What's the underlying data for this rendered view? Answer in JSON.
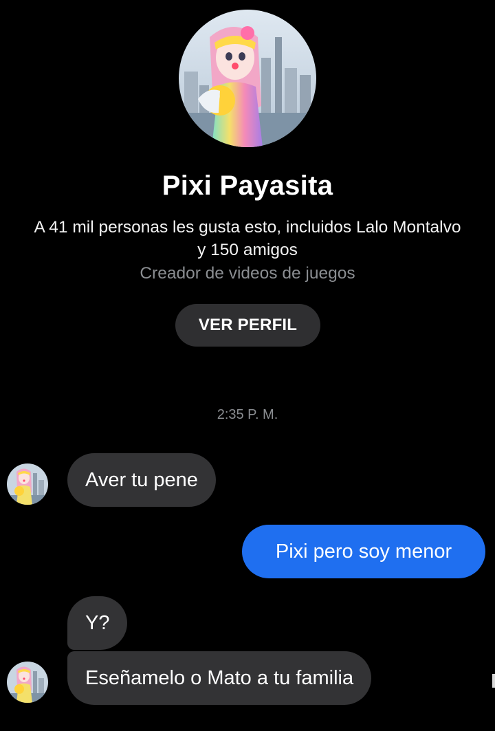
{
  "profile": {
    "name": "Pixi Payasita",
    "likes_line": "A 41 mil personas les gusta esto, incluidos Lalo Montalvo y 150 amigos",
    "category": "Creador de videos de juegos",
    "view_profile_label": "VER PERFIL"
  },
  "chat": {
    "timestamp": "2:35 P. M.",
    "messages": [
      {
        "direction": "incoming",
        "text": "Aver tu pene"
      },
      {
        "direction": "outgoing",
        "text": "Pixi pero soy menor"
      },
      {
        "direction": "incoming",
        "text": "Y?"
      },
      {
        "direction": "incoming",
        "text": "Eseñamelo o Mato a tu familia"
      }
    ]
  },
  "colors": {
    "background": "#000000",
    "incoming_bubble": "#333335",
    "outgoing_bubble": "#1f6ff0",
    "secondary_text": "#8a8d91",
    "button_background": "#2f2f31"
  }
}
